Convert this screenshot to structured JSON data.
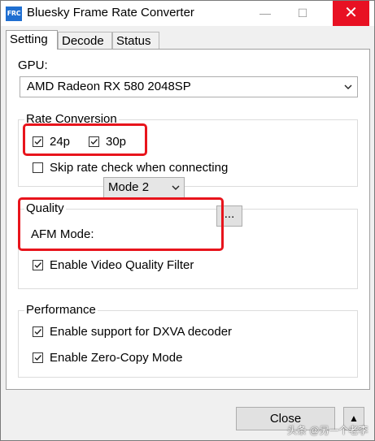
{
  "window": {
    "app_icon_text": "FRC",
    "title": "Bluesky Frame Rate Converter",
    "min_glyph": "—",
    "max_glyph": "☐",
    "close_glyph": "✕"
  },
  "tabs": [
    {
      "label": "Setting",
      "active": true
    },
    {
      "label": "Decode",
      "active": false
    },
    {
      "label": "Status",
      "active": false
    }
  ],
  "setting": {
    "gpu_label": "GPU:",
    "gpu_value": "AMD Radeon RX 580 2048SP",
    "rate_conversion": {
      "legend": "Rate Conversion",
      "cb_24p": {
        "label": "24p",
        "checked": true
      },
      "cb_30p": {
        "label": "30p",
        "checked": true
      },
      "skip_rate_check": {
        "label": "Skip rate check when connecting",
        "checked": false
      }
    },
    "quality": {
      "legend": "Quality",
      "afm_label": "AFM Mode:",
      "afm_value": "Mode 2",
      "video_filter": {
        "label": "Enable Video Quality Filter",
        "checked": true
      },
      "filter_settings_label": "..."
    },
    "performance": {
      "legend": "Performance",
      "dxva": {
        "label": "Enable support for DXVA decoder",
        "checked": true
      },
      "zero_copy": {
        "label": "Enable Zero-Copy Mode",
        "checked": true
      }
    }
  },
  "footer": {
    "close_label": "Close",
    "up_glyph": "▲"
  },
  "watermark": "头条 @另一个老李",
  "colors": {
    "highlight": "#e8141c",
    "close_hover": "#e81123",
    "icon_blue": "#1f6fd1"
  }
}
